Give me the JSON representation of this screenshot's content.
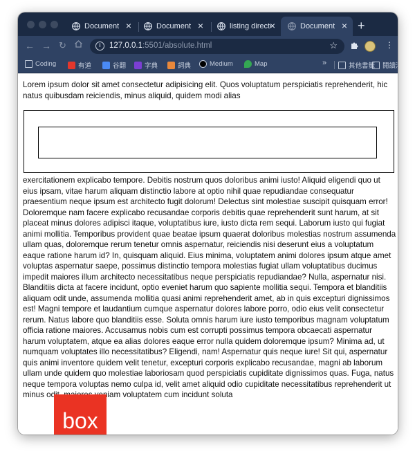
{
  "browser": {
    "tabs": [
      {
        "title": "Document",
        "active": false
      },
      {
        "title": "Document",
        "active": false
      },
      {
        "title": "listing directo",
        "active": false
      },
      {
        "title": "Document",
        "active": true
      }
    ],
    "url_host": "127.0.0.1",
    "url_port": ":5501",
    "url_path": "/absolute.html",
    "bookmarks": [
      "Coding",
      "有道",
      "谷翻",
      "字典",
      "詞典",
      "Medium",
      "Map"
    ],
    "overflow": "»",
    "other_bookmarks": "其他書籤",
    "reading_list": "閱讀清單",
    "colors": {
      "tabstrip": "#1b2a43",
      "toolbar": "#2f4263"
    }
  },
  "page": {
    "intro": "Lorem ipsum dolor sit amet consectetur adipisicing elit. Quos voluptatum perspiciatis reprehenderit, hic natus quibusdam reiciendis, minus aliquid, quidem modi alias",
    "body": "exercitationem explicabo tempore. Debitis nostrum quos doloribus animi iusto! Aliquid eligendi quo ut eius ipsam, vitae harum aliquam distinctio labore at optio nihil quae repudiandae consequatur praesentium neque ipsum est architecto fugit dolorum! Delectus sint molestiae suscipit quisquam error! Doloremque nam facere explicabo recusandae corporis debitis quae reprehenderit sunt harum, at sit placeat minus dolores adipisci itaque, voluptatibus iure, iusto dicta rem sequi. Laborum iusto qui fugiat animi mollitia. Temporibus provident quae beatae ipsum quaerat doloribus molestias nostrum assumenda ullam quas, doloremque rerum tenetur omnis aspernatur, reiciendis nisi deserunt eius a voluptatum eaque ratione harum id? In, quisquam aliquid. Eius minima, voluptatem animi dolores ipsum atque amet voluptas aspernatur saepe, possimus distinctio tempora molestias fugiat ullam voluptatibus ducimus impedit maiores illum architecto necessitatibus neque perspiciatis repudiandae? Nulla, aspernatur nisi. Blanditiis dicta at facere incidunt, optio eveniet harum quo sapiente mollitia sequi. Tempora et blanditiis aliquam odit unde, assumenda mollitia quasi animi reprehenderit amet, ab in quis excepturi dignissimos est! Magni tempore et laudantium cumque aspernatur dolores labore porro, odio eius velit consectetur rerum. Natus labore quo blanditiis esse. Soluta omnis harum iure iusto temporibus magnam voluptatum officia ratione maiores. Accusamus nobis cum est corrupti possimus tempora obcaecati aspernatur harum voluptatem, atque ea alias dolores eaque error nulla quidem doloremque ipsum? Minima ad, ut numquam voluptates illo necessitatibus? Eligendi, nam! Aspernatur quis neque iure! Sit qui, aspernatur quis animi inventore quidem velit tenetur, excepturi corporis explicabo recusandae, magni ab laborum ullam unde quidem quo molestiae laboriosam quod perspiciatis cupiditate dignissimos quas. Fuga, natus neque tempora voluptas nemo culpa id, velit amet aliquid odio cupiditate necessitatibus reprehenderit ut minus odit, maiores veniam voluptatem cum incidunt soluta",
    "box_label": "box",
    "box_color": "#ea3323"
  }
}
